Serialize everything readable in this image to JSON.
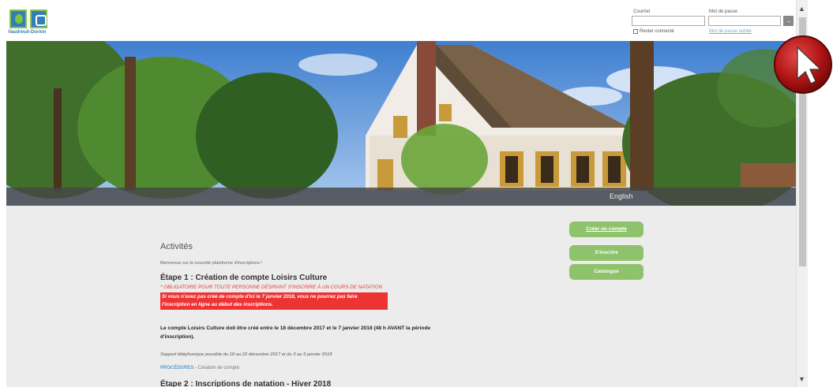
{
  "header": {
    "logo_text": "Vaudreuil-Dorion",
    "login": {
      "email_label": "Courriel",
      "password_label": "Mot de passe",
      "email_value": "",
      "password_value": "",
      "go_label": "→",
      "remember_label": "Rester connecté",
      "forgot_label": "Mot de passe oublié"
    }
  },
  "banner": {
    "language_link": "English"
  },
  "main": {
    "title": "Activités",
    "welcome": "Bienvenue sur la nouvelle plateforme d'inscriptions !",
    "step1_title": "Étape 1 : Création de compte Loisirs Culture",
    "step1_mandatory": "* OBLIGATOIRE POUR TOUTE PERSONNE DÉSIRANT S'INSCRIRE À UN COURS DE NATATION",
    "step1_alert_line1": "Si vous n'avez pas créé de compte d'ici le 7 janvier 2018, vous ne pourrez pas faire",
    "step1_alert_line2": "l'inscription en ligne au début des inscriptions.",
    "account_info": "Le compte Loisirs Culture doit être créé entre le 18 décembre 2017 et le 7 janvier 2018 (48 h AVANT la période d'inscription).",
    "support": "Support téléphonique possible du 18 au 22 décembre 2017 et du 3 au 5 janvier 2018",
    "procedures_link": "PROCÉDURES",
    "procedures_text": " - Création de compte",
    "step2_title": "Étape 2 : Inscriptions de natation - Hiver 2018"
  },
  "actions": {
    "create_account": "Créer un compte",
    "register": "S'inscrire",
    "catalog": "Catalogue"
  },
  "colors": {
    "button_green": "#8ec26b",
    "alert_red": "#ee3333",
    "link_blue": "#5aa0d4"
  }
}
